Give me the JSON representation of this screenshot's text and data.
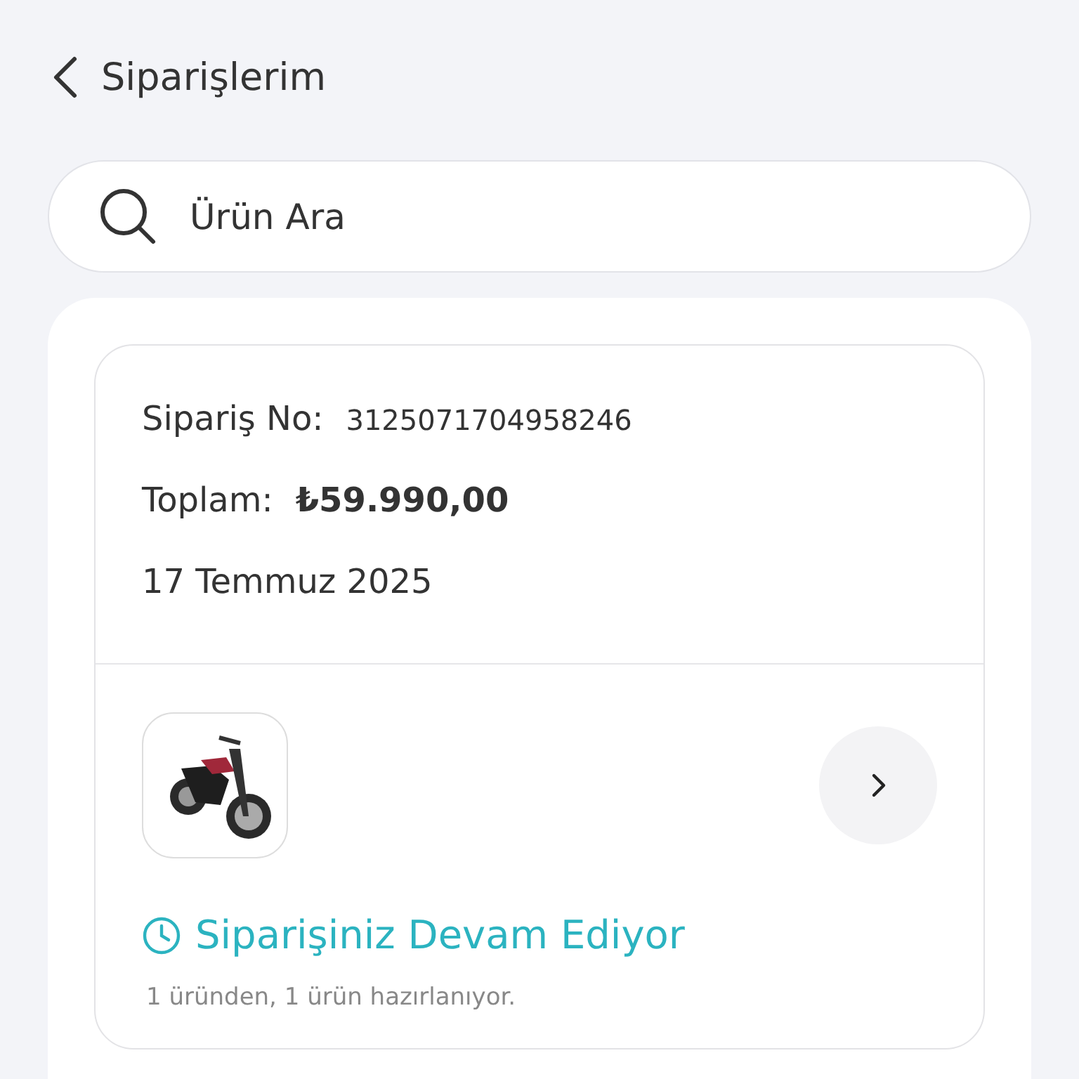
{
  "header": {
    "title": "Siparişlerim"
  },
  "search": {
    "placeholder": "Ürün Ara"
  },
  "order": {
    "number_label": "Sipariş No:",
    "number": "3125071704958246",
    "total_label": "Toplam:",
    "total": "₺59.990,00",
    "date": "17 Temmuz 2025",
    "status": {
      "kind": "in_progress",
      "text": "Siparişiniz Devam Ediyor"
    },
    "summary": "1 üründen, 1 ürün hazırlanıyor."
  }
}
